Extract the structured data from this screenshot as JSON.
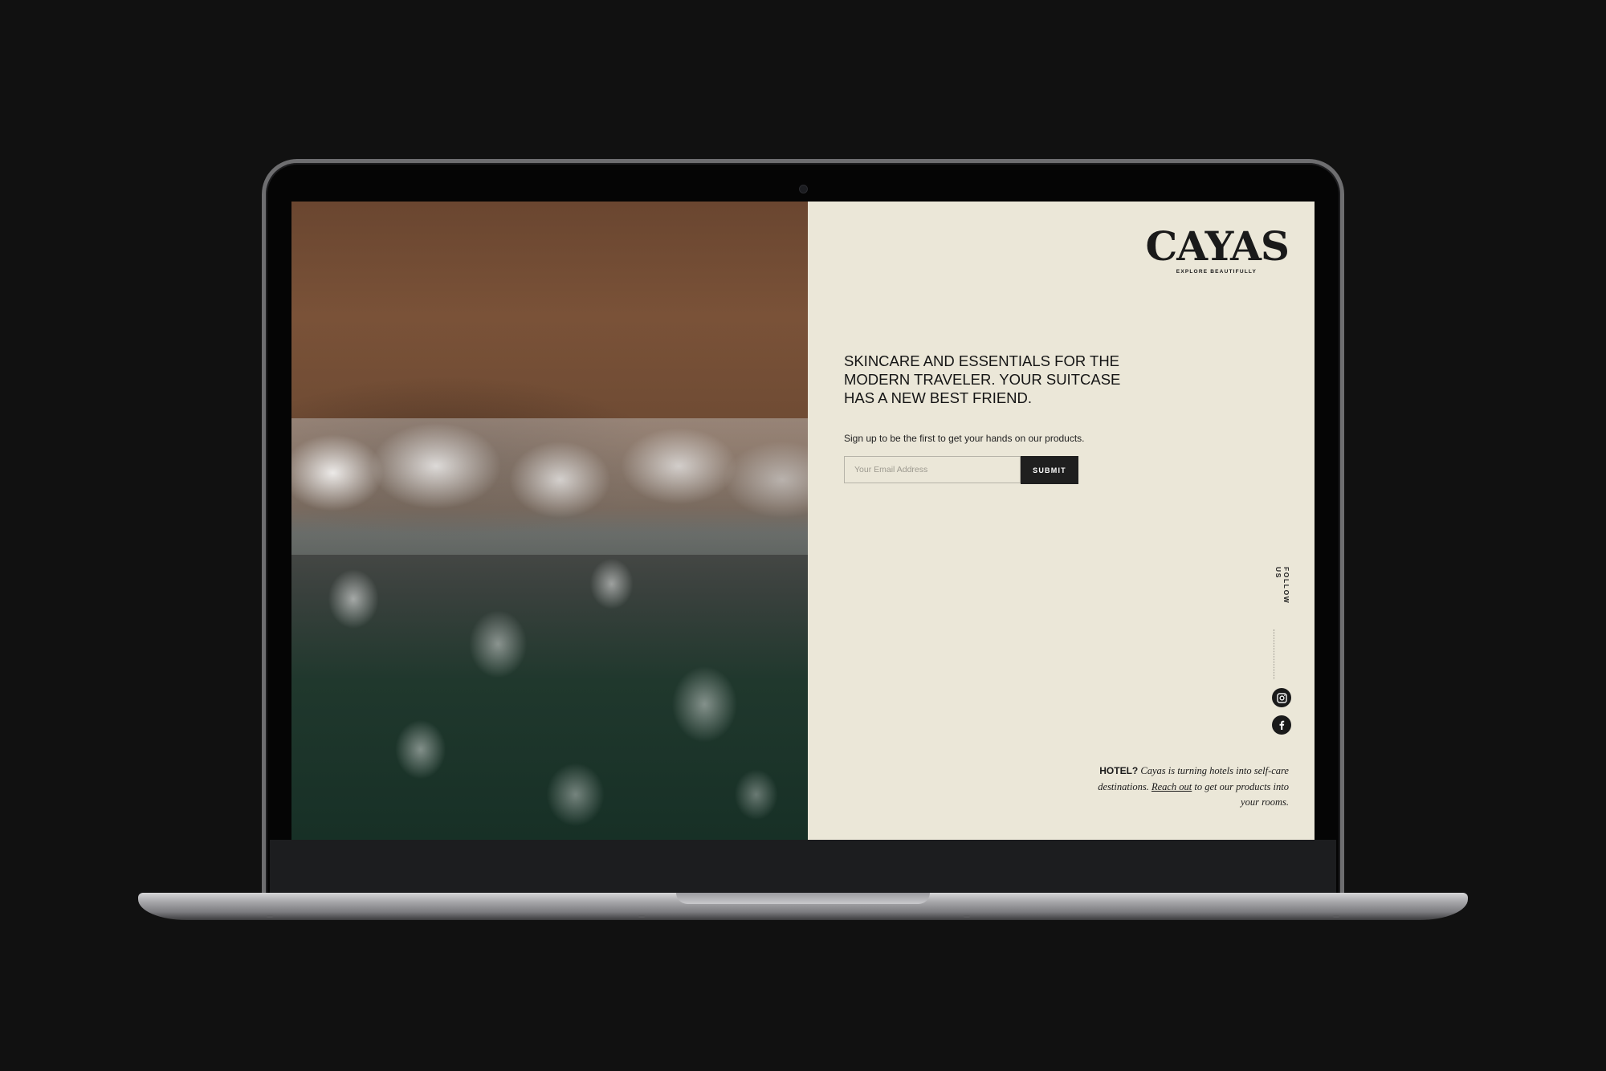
{
  "brand": {
    "name": "CAYAS",
    "tagline": "EXPLORE BEAUTIFULLY"
  },
  "hero": {
    "headline": "SKINCARE AND ESSENTIALS FOR THE MODERN TRAVELER. YOUR SUITCASE HAS A NEW BEST FRIEND."
  },
  "signup": {
    "text": "Sign up to be the first to get your hands on our products.",
    "email_placeholder": "Your Email Address",
    "submit_label": "SUBMIT"
  },
  "social": {
    "follow_label": "FOLLOW US",
    "icons": [
      "instagram-icon",
      "facebook-icon"
    ]
  },
  "hotel": {
    "lead": "HOTEL?",
    "text_before": " Cayas is turning hotels into self-care destinations. ",
    "link": "Reach out",
    "text_after": " to get our products into your rooms."
  },
  "colors": {
    "panel_background": "#ebe7d8",
    "button_background": "#1f1f1f",
    "page_background": "#111111"
  }
}
